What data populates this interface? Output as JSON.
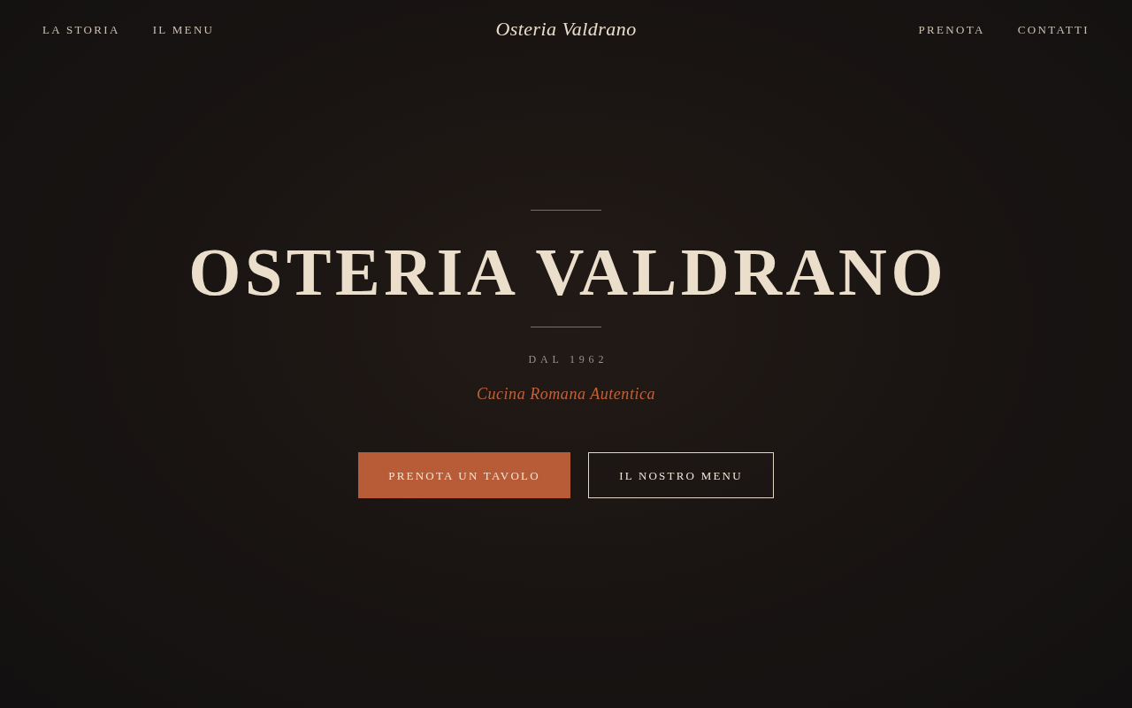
{
  "nav": {
    "left_links": [
      "LA STORIA",
      "IL MENU"
    ],
    "brand": "Osteria Valdrano",
    "right_links": [
      "PRENOTA",
      "CONTATTI"
    ]
  },
  "hero": {
    "title": "OSTERIA VALDRANO",
    "since": "DAL 1962",
    "tagline": "Cucina Romana Autentica",
    "buttons": [
      {
        "label": "PRENOTA UN TAVOLO",
        "kind": "primary"
      },
      {
        "label": "IL NOSTRO MENU",
        "kind": "outline"
      }
    ]
  }
}
